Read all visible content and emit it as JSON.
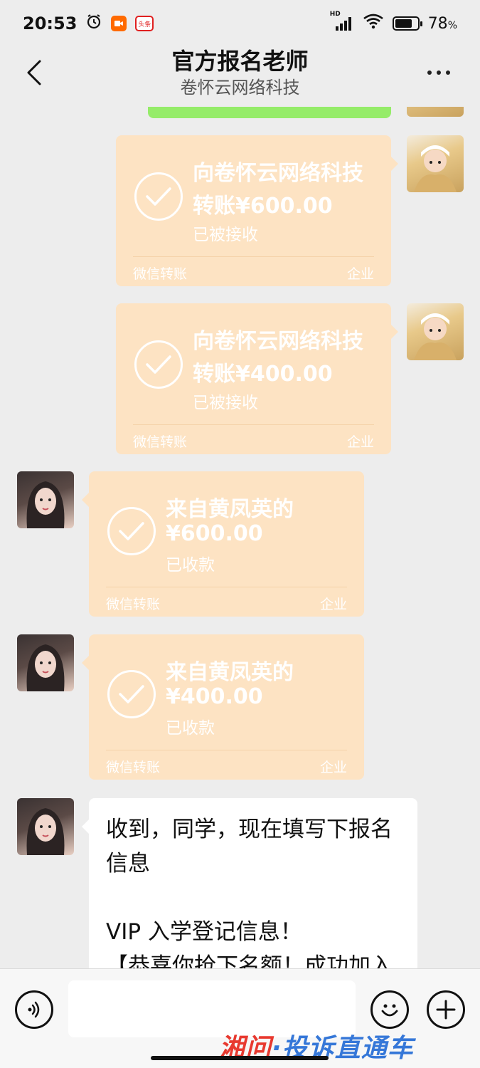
{
  "status_bar": {
    "time": "20:53",
    "app_badge_label": "头条",
    "network": "HD",
    "battery": "78",
    "battery_unit": "%",
    "battery_level": 0.78
  },
  "header": {
    "title": "官方报名老师",
    "subtitle": "卷怀云网络科技"
  },
  "messages": {
    "t1": {
      "line1": "向卷怀云网络科技",
      "line2": "转账¥600.00",
      "status": "已被接收",
      "footer_left": "微信转账",
      "footer_right": "企业"
    },
    "t2": {
      "line1": "向卷怀云网络科技",
      "line2": "转账¥400.00",
      "status": "已被接收",
      "footer_left": "微信转账",
      "footer_right": "企业"
    },
    "t3": {
      "line1": "来自黄凤英的",
      "line2": "¥600.00",
      "status": "已收款",
      "footer_left": "微信转账",
      "footer_right": "企业"
    },
    "t4": {
      "line1": "来自黄凤英的",
      "line2": "¥400.00",
      "status": "已收款",
      "footer_left": "微信转账",
      "footer_right": "企业"
    },
    "text1": {
      "line1": "收到，同学，现在填写下报名",
      "line2": "信息",
      "line3": "VIP 入学登记信息！",
      "line4": "【恭喜你抢下名额！成功加入"
    }
  },
  "input_bar": {
    "placeholder": ""
  },
  "watermark": {
    "part1": "湘问",
    "part2": "·投诉直通车"
  },
  "icons": {
    "back": "chevron-left-icon",
    "more": "more-icon",
    "check": "check-circle-icon",
    "voice": "voice-icon",
    "emoji": "emoji-icon",
    "add": "plus-icon"
  }
}
